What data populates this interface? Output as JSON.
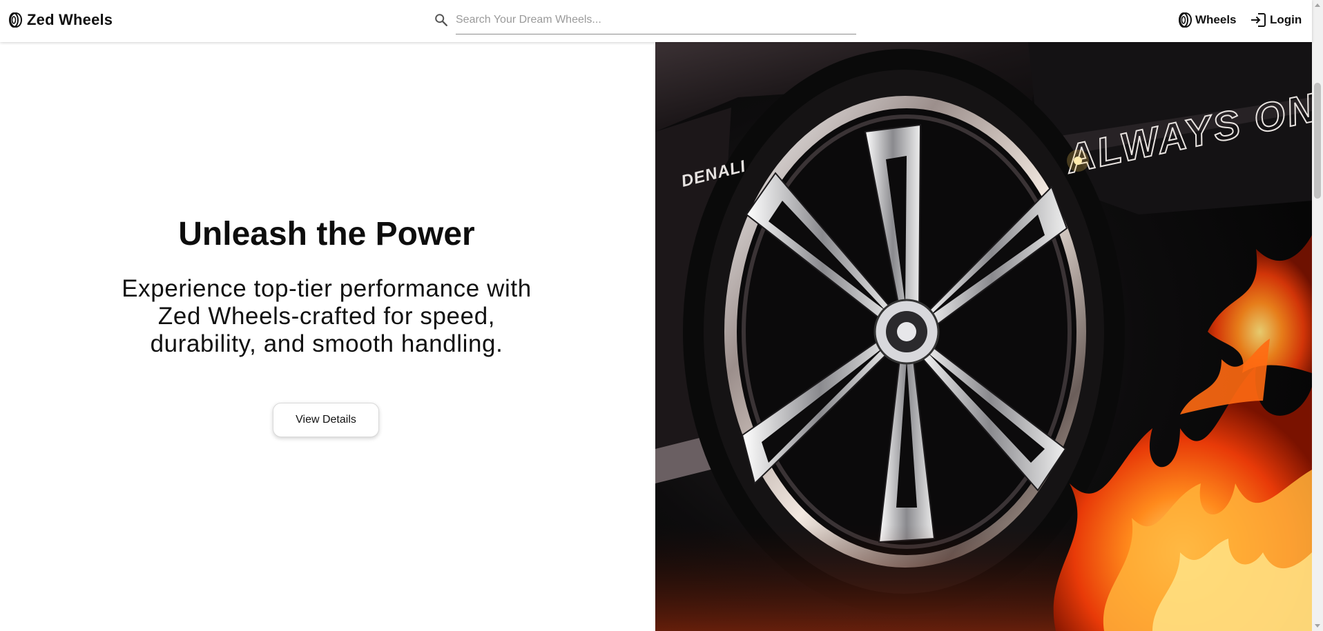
{
  "header": {
    "brand": {
      "name": "Zed Wheels",
      "icon": "tire-icon"
    },
    "search": {
      "placeholder": "Search Your Dream Wheels...",
      "value": "",
      "icon": "search-icon"
    },
    "nav": [
      {
        "label": "Wheels",
        "icon": "tire-icon"
      },
      {
        "label": "Login",
        "icon": "login-icon"
      }
    ]
  },
  "hero": {
    "title": "Unleash the Power",
    "description": "Experience top-tier performance with Zed Wheels-crafted for speed, durability, and smooth handling.",
    "button_label": "View Details",
    "image": {
      "subject": "chrome-spoke-wheel-with-flames",
      "lettering": [
        "DENALI",
        "ALWAYS ON"
      ]
    }
  },
  "colors": {
    "background": "#ffffff",
    "text": "#111111",
    "flame": "#ff5a10",
    "image_dark": "#080808"
  }
}
